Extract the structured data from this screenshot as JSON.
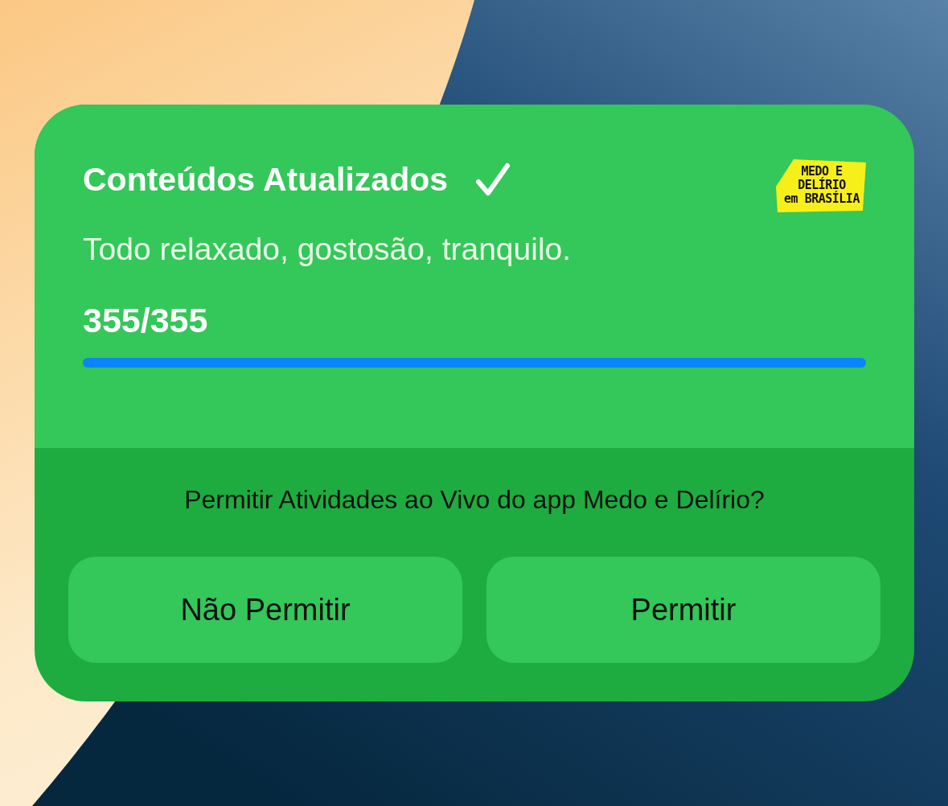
{
  "activity": {
    "title": "Conteúdos Atualizados",
    "subtitle": "Todo relaxado, gostosão, tranquilo.",
    "count": "355/355",
    "logo": {
      "lines": [
        "MEDO E",
        "DELÍRIO",
        "em BRASÍLIA"
      ]
    }
  },
  "prompt": {
    "question": "Permitir Atividades ao Vivo do app Medo e Delírio?",
    "buttons": [
      {
        "label": "Não Permitir"
      },
      {
        "label": "Permitir"
      }
    ]
  }
}
